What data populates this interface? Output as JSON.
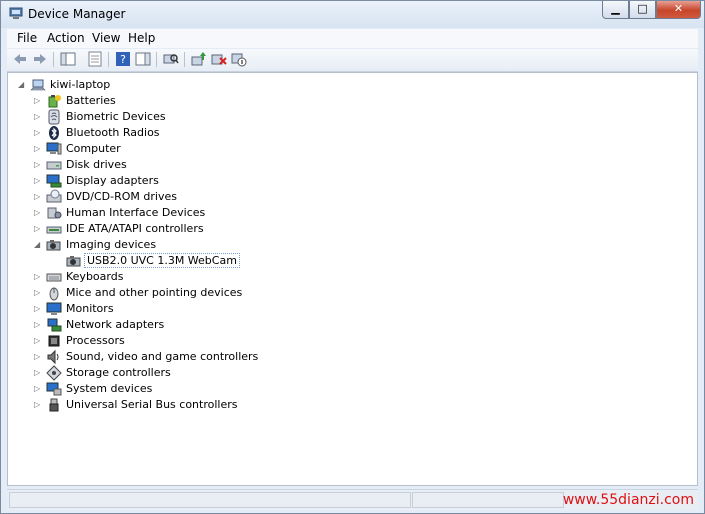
{
  "window": {
    "title": "Device Manager"
  },
  "menu": [
    {
      "label": "File"
    },
    {
      "label": "Action"
    },
    {
      "label": "View"
    },
    {
      "label": "Help"
    }
  ],
  "toolbar": {
    "buttons": [
      "back-arrow-icon",
      "forward-arrow-icon",
      "show-hide-console-tree-icon",
      "properties-icon",
      "help-icon",
      "action-pane-icon",
      "scan-hardware-icon",
      "update-driver-icon",
      "uninstall-icon",
      "disable-device-icon"
    ]
  },
  "tree": {
    "root": "kiwi-laptop",
    "items": [
      {
        "label": "Batteries",
        "icon": "battery-icon"
      },
      {
        "label": "Biometric Devices",
        "icon": "fingerprint-icon"
      },
      {
        "label": "Bluetooth Radios",
        "icon": "bluetooth-icon"
      },
      {
        "label": "Computer",
        "icon": "computer-icon"
      },
      {
        "label": "Disk drives",
        "icon": "disk-drive-icon"
      },
      {
        "label": "Display adapters",
        "icon": "display-adapter-icon"
      },
      {
        "label": "DVD/CD-ROM drives",
        "icon": "dvd-drive-icon"
      },
      {
        "label": "Human Interface Devices",
        "icon": "hid-icon"
      },
      {
        "label": "IDE ATA/ATAPI controllers",
        "icon": "ide-controller-icon"
      },
      {
        "label": "Imaging devices",
        "icon": "camera-icon",
        "expanded": true
      },
      {
        "label": "USB2.0 UVC 1.3M WebCam",
        "icon": "webcam-icon",
        "child": true,
        "selected": true
      },
      {
        "label": "Keyboards",
        "icon": "keyboard-icon"
      },
      {
        "label": "Mice and other pointing devices",
        "icon": "mouse-icon"
      },
      {
        "label": "Monitors",
        "icon": "monitor-icon"
      },
      {
        "label": "Network adapters",
        "icon": "network-icon"
      },
      {
        "label": "Processors",
        "icon": "processor-icon"
      },
      {
        "label": "Sound, video and game controllers",
        "icon": "speaker-icon"
      },
      {
        "label": "Storage controllers",
        "icon": "storage-controller-icon"
      },
      {
        "label": "System devices",
        "icon": "system-devices-icon"
      },
      {
        "label": "Universal Serial Bus controllers",
        "icon": "usb-icon"
      }
    ]
  },
  "watermark": "www.55dianzi.com"
}
